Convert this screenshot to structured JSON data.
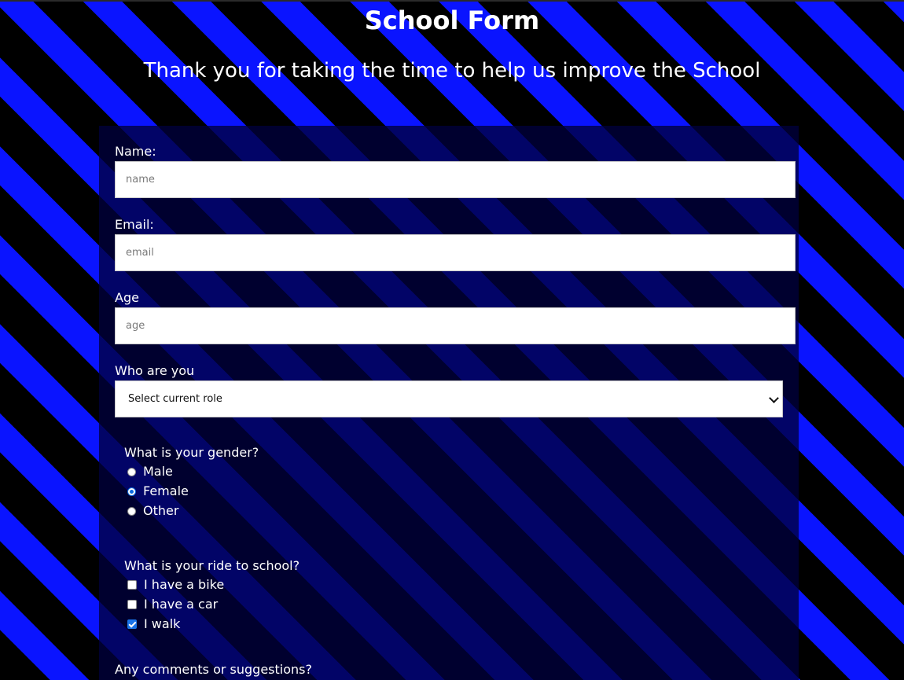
{
  "header": {
    "title": "School Form",
    "subtitle": "Thank you for taking the time to help us improve the School"
  },
  "form": {
    "name": {
      "label": "Name:",
      "placeholder": "name",
      "value": ""
    },
    "email": {
      "label": "Email:",
      "placeholder": "email",
      "value": ""
    },
    "age": {
      "label": "Age",
      "placeholder": "age",
      "value": ""
    },
    "role": {
      "label": "Who are you",
      "selected": "Select current role"
    },
    "gender": {
      "question": "What is your gender?",
      "options": [
        {
          "label": "Male",
          "checked": false
        },
        {
          "label": "Female",
          "checked": true
        },
        {
          "label": "Other",
          "checked": false
        }
      ]
    },
    "ride": {
      "question": "What is your ride to school?",
      "options": [
        {
          "label": "I have a bike",
          "checked": false
        },
        {
          "label": "I have a car",
          "checked": false
        },
        {
          "label": "I walk",
          "checked": true
        }
      ]
    },
    "comments": {
      "label": "Any comments or suggestions?"
    }
  },
  "colors": {
    "stripe_dark": "#000000",
    "stripe_accent": "#0a14ff",
    "panel": "#00003c",
    "checked_accent": "#1a73e8"
  }
}
